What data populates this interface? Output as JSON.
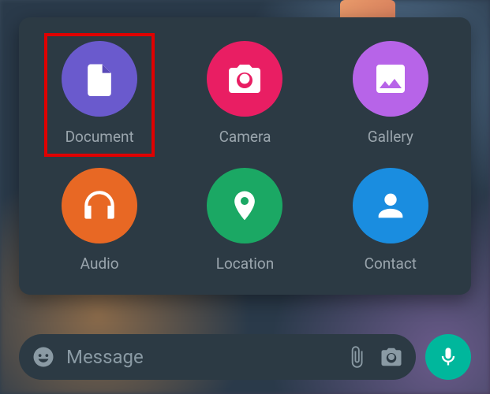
{
  "attachPanel": {
    "options": {
      "document": {
        "label": "Document",
        "color": "#6a5acd",
        "highlighted": true
      },
      "camera": {
        "label": "Camera",
        "color": "#e91e63"
      },
      "gallery": {
        "label": "Gallery",
        "color": "#b764e8"
      },
      "audio": {
        "label": "Audio",
        "color": "#e86824"
      },
      "location": {
        "label": "Location",
        "color": "#1ba864"
      },
      "contact": {
        "label": "Contact",
        "color": "#1a8de0"
      }
    }
  },
  "inputBar": {
    "placeholder": "Message"
  }
}
